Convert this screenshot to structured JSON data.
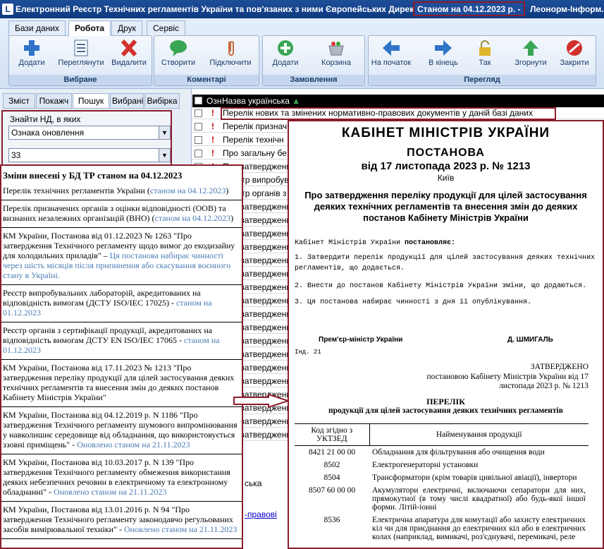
{
  "window": {
    "title": "Електронний Реєстр Технічних регламентів України та пов'язаних з ними Європейських Директив",
    "status": "Станом на 04.12.2023 р. -",
    "title_suffix": "Леонорм-Інформ..."
  },
  "ribbon": {
    "tabs": [
      "Бази даних",
      "Робота",
      "Друк",
      "Сервіс"
    ],
    "groups": {
      "favorites": {
        "label": "Вибране",
        "buttons": [
          "Додати",
          "Переглянути",
          "Видалити"
        ]
      },
      "comments": {
        "label": "Коментарі",
        "buttons": [
          "Створити",
          "Підключити"
        ]
      },
      "orders": {
        "label": "Замовлення",
        "buttons": [
          "Додати",
          "Корзина"
        ]
      },
      "view": {
        "label": "Перегляд",
        "buttons": [
          "На початок",
          "В кінець",
          "Так",
          "Згорнути",
          "Закрити"
        ]
      }
    }
  },
  "left_panel": {
    "tabs": [
      "Зміст",
      "Покажч",
      "Пошук",
      "Вибрані",
      "Вибірка"
    ],
    "find_label": "Знайти НД, в яких",
    "criteria_value": "Ознака оновлення",
    "value_field": "33"
  },
  "grid": {
    "col_mark": "Озн",
    "col_name": "Назва українська",
    "rows": [
      "Перелік нових та змінених нормативно-правових документів у даній базі даних",
      "Перелік признач",
      "Перелік технічн",
      "Про загальну бе",
      "Про затвердження бу",
      "Реєстр випробув",
      "Реєстр органів з",
      "Про затвердженн",
      "Про затвердженн",
      "Про затвердженн",
      "Про затвердженн",
      "Про затвердженн",
      "Про затвердженн",
      "Про затвердженн",
      "Про затвердженн",
      "Про затвердженн",
      "Про затвердженн",
      "Про затвердженн",
      "Про затвердженн",
      "Про затвердженн",
      "Про затвердженн",
      "Про затвердженн",
      "Про затвердженн",
      "Про затвердженн",
      "Про затвердженн"
    ],
    "lower_text_1": "ська",
    "lower_text_2": "-правові"
  },
  "changes": {
    "heading": "Зміни внесені у БД ТР станом на 04.12.2023",
    "items": [
      {
        "text": "Перелік технічних регламентів України (",
        "link": "станом на 04.12.2023",
        "tail": ")"
      },
      {
        "text": "Перелік призначених органів з оцінки відповідності (ООВ) та визнаних незалежних організацій (ВНО) (",
        "link": "станом на 04.12.2023",
        "tail": ")"
      },
      {
        "text": "КМ України, Постанова від 01.12.2023 № 1263 \"Про затвердження Технічного регламенту щодо вимог до екодизайну для холодильних приладів\" – ",
        "link": "Ця постанова набирає чинності через шість місяців після припинення або скасування воєнного стану в Україні.",
        "tail": ""
      },
      {
        "text": "Реєстр випробувальних лабораторій, акредитованих на відповідність вимогам (ДСТУ ISO/IEC 17025) - ",
        "link": "станом на 01.12.2023",
        "tail": ""
      },
      {
        "text": "Реєстр органів з сертифікації продукції, акредитованих на відповідність вимогам ДСТУ EN ISO/IEC 17065 - ",
        "link": "станом на 01.12.2023",
        "tail": ""
      },
      {
        "text": "КМ України, Постанова від 17.11.2023 № 1213 \"Про затвердження переліку продукції для цілей застосування деяких технічних регламентів та внесення змін до деяких постанов Кабінету Міністрів України\"",
        "link": "",
        "tail": ""
      },
      {
        "text": "КМ України, Постанова від 04.12.2019 р. N 1186 \"Про затвердження Технічного регламенту шумового випромінювання у навколишнє середовище від обладнання, що використовується ззовні приміщень\" - ",
        "link": "Оновлено станом на 21.11.2023",
        "tail": ""
      },
      {
        "text": "КМ України, Постанова від 10.03.2017 р. N 139 \"Про затвердження Технічного регламенту обмеження використання деяких небезпечних речовин в електричному та електронному обладнанні\" - ",
        "link": "Оновлено станом на 21.11.2023",
        "tail": ""
      },
      {
        "text": "КМ України, Постанова від 13.01.2016 р. N 94 \"Про затвердження Технічного регламенту законодавчо регульованих засобів вимірювальної техніки\" - ",
        "link": "Оновлено станом на 21.11.2023",
        "tail": ""
      }
    ]
  },
  "doc": {
    "org": "КАБІНЕТ МІНІСТРІВ УКРАЇНИ",
    "type": "ПОСТАНОВА",
    "date": "від 17 листопада 2023 р. № 1213",
    "city": "Київ",
    "title": "Про затвердження переліку продукції для цілей застосування деяких технічних регламентів та внесення змін до деяких постанов Кабінету Міністрів України",
    "intro": "Кабінет Міністрів України ",
    "intro_bold": "постановляє:",
    "p1": "1. Затвердити перелік продукції для цілей застосування деяких технічних регламентів, що додається.",
    "p2": "2. Внести до постанов Кабінету Міністрів України зміни, що додаються.",
    "p3": "3. Ця постанова набирає чинності з дня її опублікування.",
    "pm_label": "Прем'єр-міністр України",
    "pm_name": "Д. ШМИГАЛЬ",
    "ind": "Інд. 21",
    "approved": "ЗАТВЕРДЖЕНО",
    "approved_by": "постановою Кабінету Міністрів України від 17 листопада 2023 р. № 1213",
    "list_title": "ПЕРЕЛІК",
    "list_sub": "продукції для цілей застосування деяких технічних регламентів",
    "th1": "Код згідно з УКТЗЕД",
    "th2": "Найменування продукції",
    "rows": [
      {
        "code": "8421 21 00 00",
        "name": "Обладнання для фільтрування або очищення води"
      },
      {
        "code": "8502",
        "name": "Електрогенераторні установки"
      },
      {
        "code": "8504",
        "name": "Трансформатори (крім товарів цивільної авіації), інвертори"
      },
      {
        "code": "8507 60 00 00",
        "name": "Акумулятори електричні, включаючи сепаратори для них, прямокутної (в тому числі квадратної) або будь-якої іншої форми. Літій-іонні"
      },
      {
        "code": "8536",
        "name": "Електрична апаратура для комутації або захисту електричних кіл чи для приєднання до електричних кіл або в електричних колах (наприклад, вимикачі, роз'єднувачі, перемикачі, реле"
      }
    ]
  }
}
